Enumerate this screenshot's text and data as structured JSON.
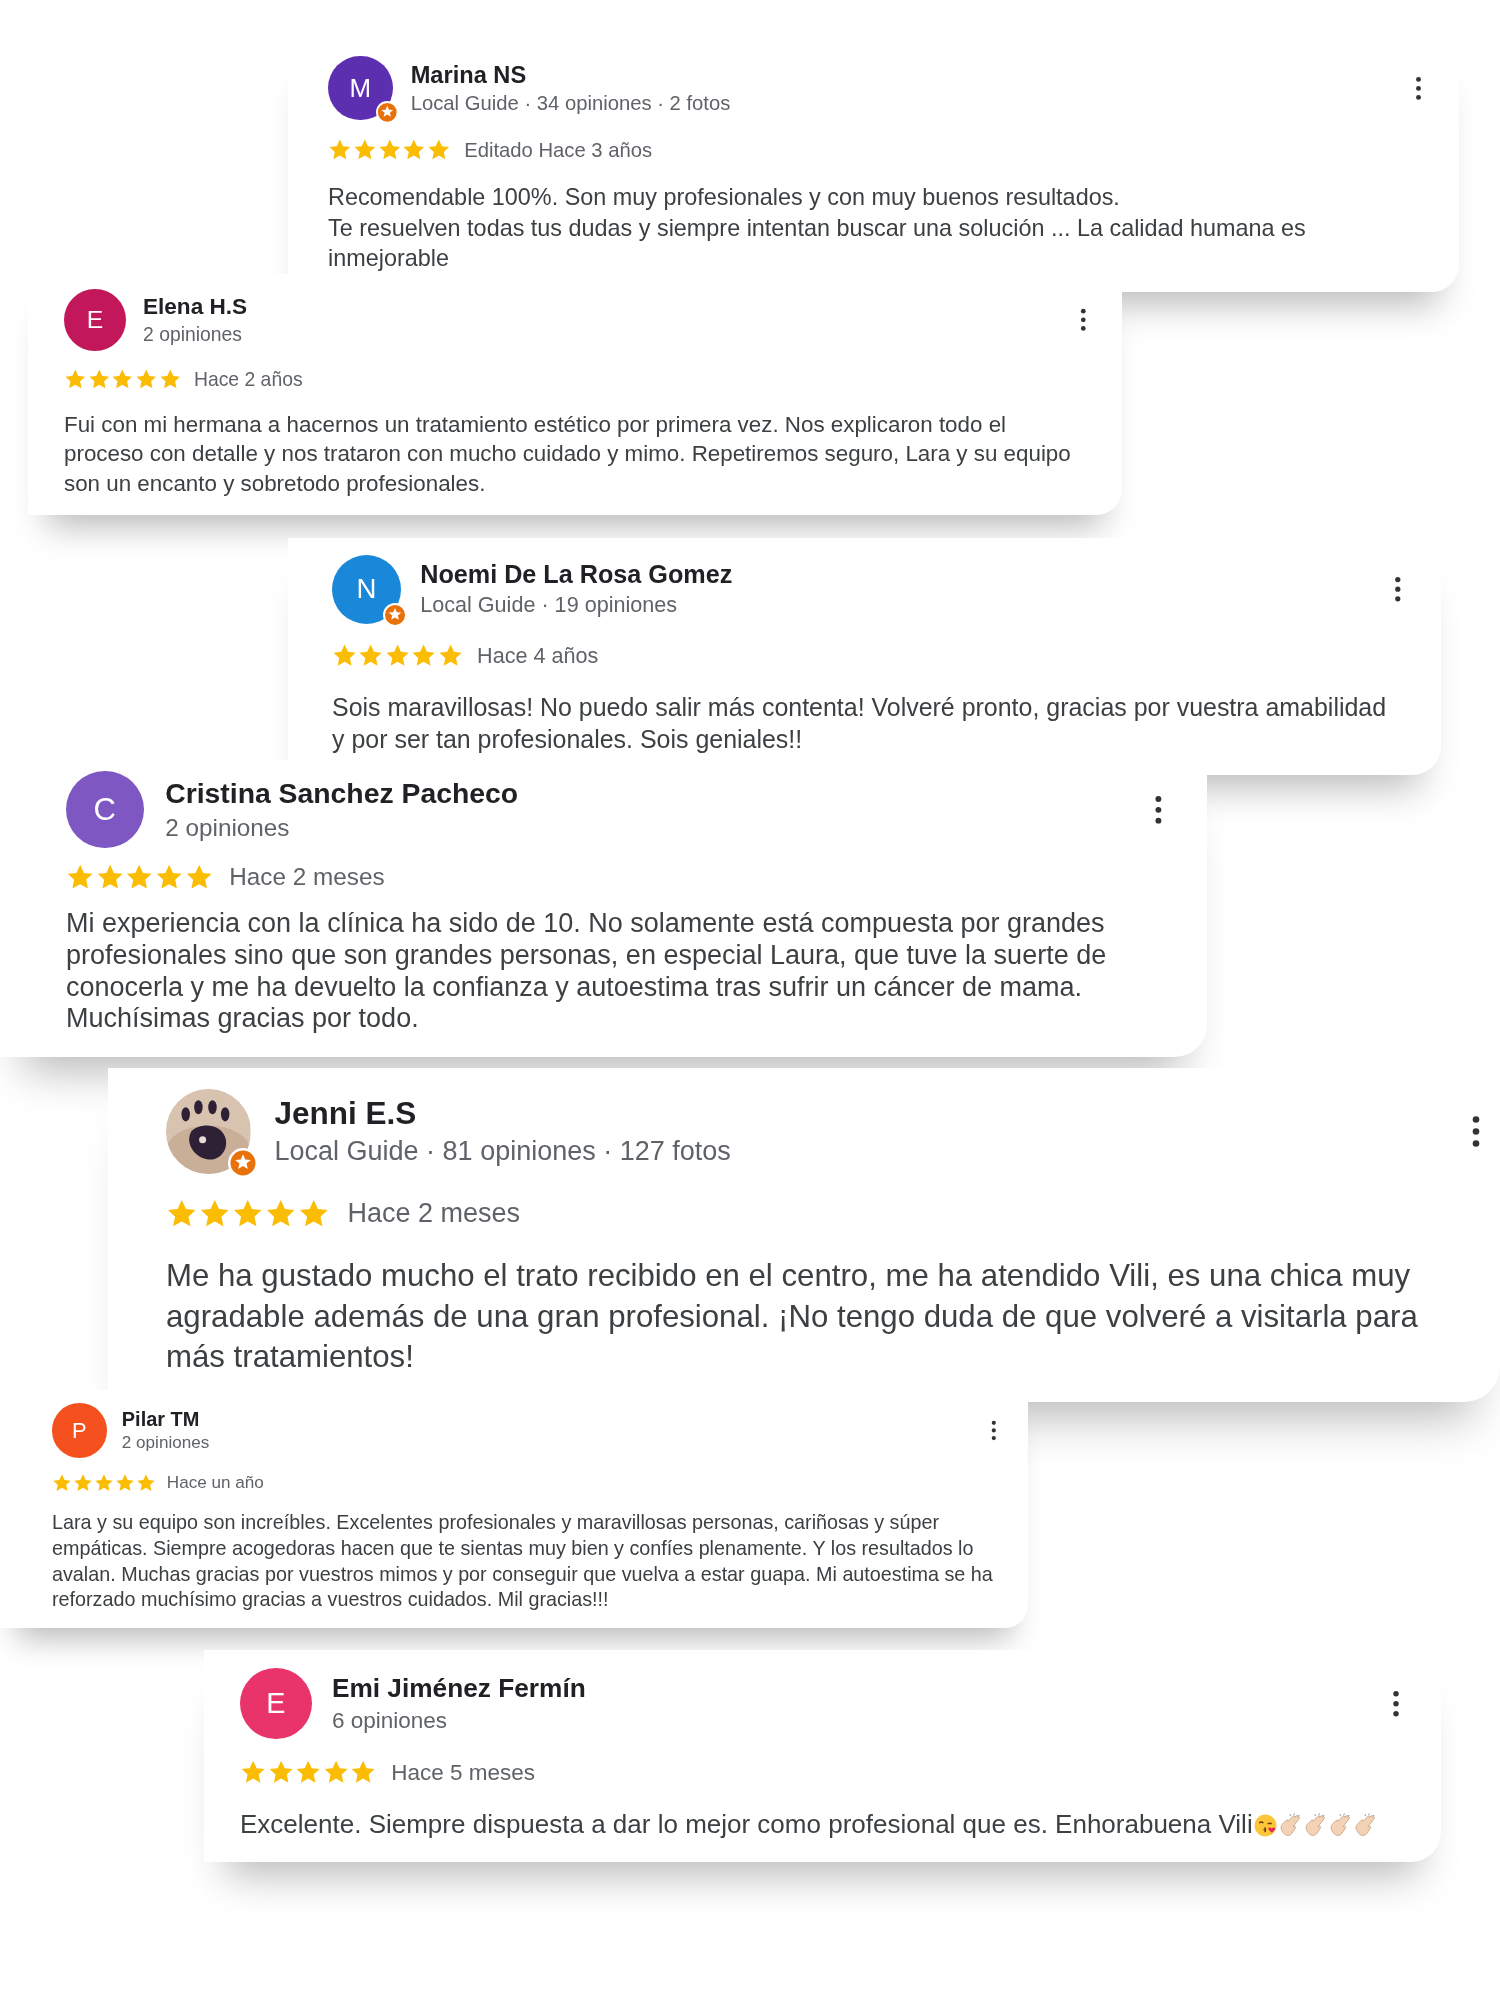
{
  "reviews": [
    {
      "name": "Marina NS",
      "meta": "Local Guide · 34 opiniones · 2 fotos",
      "avatar": {
        "kind": "letter",
        "letter": "M",
        "color": "#5b2fb0"
      },
      "local_guide": true,
      "stars": 5,
      "date": "Editado Hace 3 años",
      "paragraphs": [
        "Recomendable 100%. Son muy profesionales y con muy buenos resultados.",
        "Te resuelven todas tus dudas y siempre intentan buscar una solución ... La calidad humana es inmejorable"
      ]
    },
    {
      "name": "Elena H.S",
      "meta": "2 opiniones",
      "avatar": {
        "kind": "letter",
        "letter": "E",
        "color": "#c2185b"
      },
      "local_guide": false,
      "stars": 5,
      "date": "Hace 2 años",
      "paragraphs": [
        "Fui con mi hermana a hacernos un tratamiento estético por primera vez. Nos explicaron todo el proceso con detalle y nos trataron con mucho cuidado y mimo. Repetiremos seguro, Lara y su equipo son un encanto y sobretodo profesionales."
      ]
    },
    {
      "name": "Noemi De La Rosa Gomez",
      "meta": "Local Guide · 19 opiniones",
      "avatar": {
        "kind": "letter",
        "letter": "N",
        "color": "#1a88d8"
      },
      "local_guide": true,
      "stars": 5,
      "date": "Hace 4 años",
      "paragraphs": [
        "Sois maravillosas! No puedo salir más contenta! Volveré pronto, gracias por vuestra amabilidad y por ser tan profesionales. Sois geniales!!"
      ]
    },
    {
      "name": "Cristina Sanchez Pacheco",
      "meta": "2 opiniones",
      "avatar": {
        "kind": "letter",
        "letter": "C",
        "color": "#7e57c2"
      },
      "local_guide": false,
      "stars": 5,
      "date": "Hace 2 meses",
      "paragraphs": [
        "Mi experiencia con la clínica ha sido de 10. No solamente está compuesta por grandes profesionales sino que son grandes personas, en especial Laura, que tuve la suerte de conocerla y me ha devuelto la confianza y autoestima tras sufrir un cáncer de mama. Muchísimas gracias por todo."
      ]
    },
    {
      "name": "Jenni E.S",
      "meta": "Local Guide · 81 opiniones · 127 fotos",
      "avatar": {
        "kind": "picture"
      },
      "local_guide": true,
      "stars": 5,
      "date": "Hace 2 meses",
      "paragraphs": [
        "Me ha gustado mucho el trato recibido en el centro, me ha atendido Vili, es una chica muy agradable además de una gran profesional. ¡No tengo duda de que volveré a visitarla para más tratamientos!"
      ]
    },
    {
      "name": "Pilar TM",
      "meta": "2 opiniones",
      "avatar": {
        "kind": "letter",
        "letter": "P",
        "color": "#f4511e"
      },
      "local_guide": false,
      "stars": 5,
      "date": "Hace un año",
      "paragraphs": [
        "Lara y su equipo son increíbles. Excelentes profesionales y maravillosas personas, cariñosas y súper empáticas. Siempre acogedoras hacen que te sientas muy bien y confíes plenamente. Y los resultados lo avalan. Muchas gracias por vuestros mimos y por conseguir que vuelva a estar guapa. Mi autoestima se ha reforzado muchísimo gracias a vuestros cuidados. Mil gracias!!!"
      ]
    },
    {
      "name": "Emi Jiménez Fermín",
      "meta": "6 opiniones",
      "avatar": {
        "kind": "letter",
        "letter": "E",
        "color": "#e8336b"
      },
      "local_guide": false,
      "stars": 5,
      "date": "Hace 5 meses",
      "paragraphs": [
        "Excelente. Siempre dispuesta a dar lo mejor como profesional que es. Enhorabuena Vili"
      ],
      "emojis": [
        {
          "kind": "kiss"
        },
        {
          "kind": "clap"
        },
        {
          "kind": "clap"
        },
        {
          "kind": "clap"
        },
        {
          "kind": "clap"
        }
      ]
    }
  ]
}
